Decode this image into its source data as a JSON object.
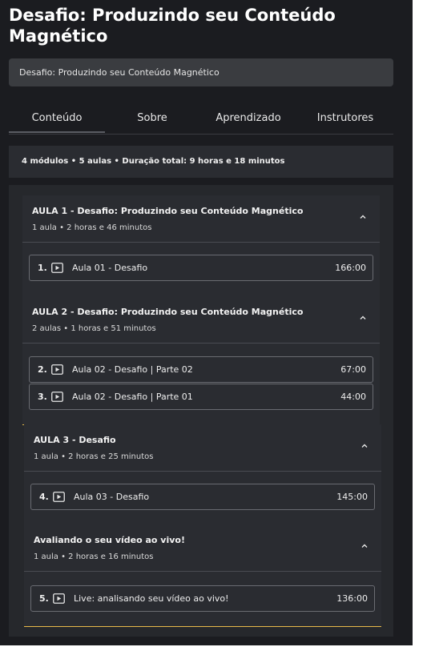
{
  "page": {
    "title": "Desafio: Produzindo seu Conteúdo Magnético",
    "breadcrumb": "Desafio: Produzindo seu Conteúdo Magnético"
  },
  "tabs": [
    {
      "label": "Conteúdo",
      "active": true
    },
    {
      "label": "Sobre",
      "active": false
    },
    {
      "label": "Aprendizado",
      "active": false
    },
    {
      "label": "Instrutores",
      "active": false
    }
  ],
  "summary": "4 módulos • 5 aulas • Duração total: 9 horas e 18 minutos",
  "modules": [
    {
      "title": "AULA 1 - Desafio: Produzindo seu Conteúdo Magnético",
      "subtitle": "1 aula • 2 horas e 46 minutos",
      "lessons": [
        {
          "number": "1.",
          "title": "Aula 01 - Desafio",
          "duration": "166:00"
        }
      ]
    },
    {
      "title": "AULA 2 - Desafio: Produzindo seu Conteúdo Magnético",
      "subtitle": "2 aulas • 1 horas e 51 minutos",
      "lessons": [
        {
          "number": "2.",
          "title": "Aula 02 - Desafio | Parte 02",
          "duration": "67:00"
        },
        {
          "number": "3.",
          "title": "Aula 02 - Desafio | Parte 01",
          "duration": "44:00"
        }
      ]
    },
    {
      "title": "AULA 3 - Desafio",
      "subtitle": "1 aula • 2 horas e 25 minutos",
      "lessons": [
        {
          "number": "4.",
          "title": "Aula 03 - Desafio",
          "duration": "145:00"
        }
      ]
    },
    {
      "title": "Avaliando o seu vídeo ao vivo!",
      "subtitle": "1 aula • 2 horas e 16 minutos",
      "lessons": [
        {
          "number": "5.",
          "title": "Live: analisando seu vídeo ao vivo!",
          "duration": "136:00"
        }
      ]
    }
  ],
  "icons": {
    "lesson": "play-video-icon",
    "collapse": "chevron-up-icon"
  },
  "colors": {
    "background": "#1b1c20",
    "panel": "#2a2c31",
    "accent_border": "#e8b94a"
  }
}
